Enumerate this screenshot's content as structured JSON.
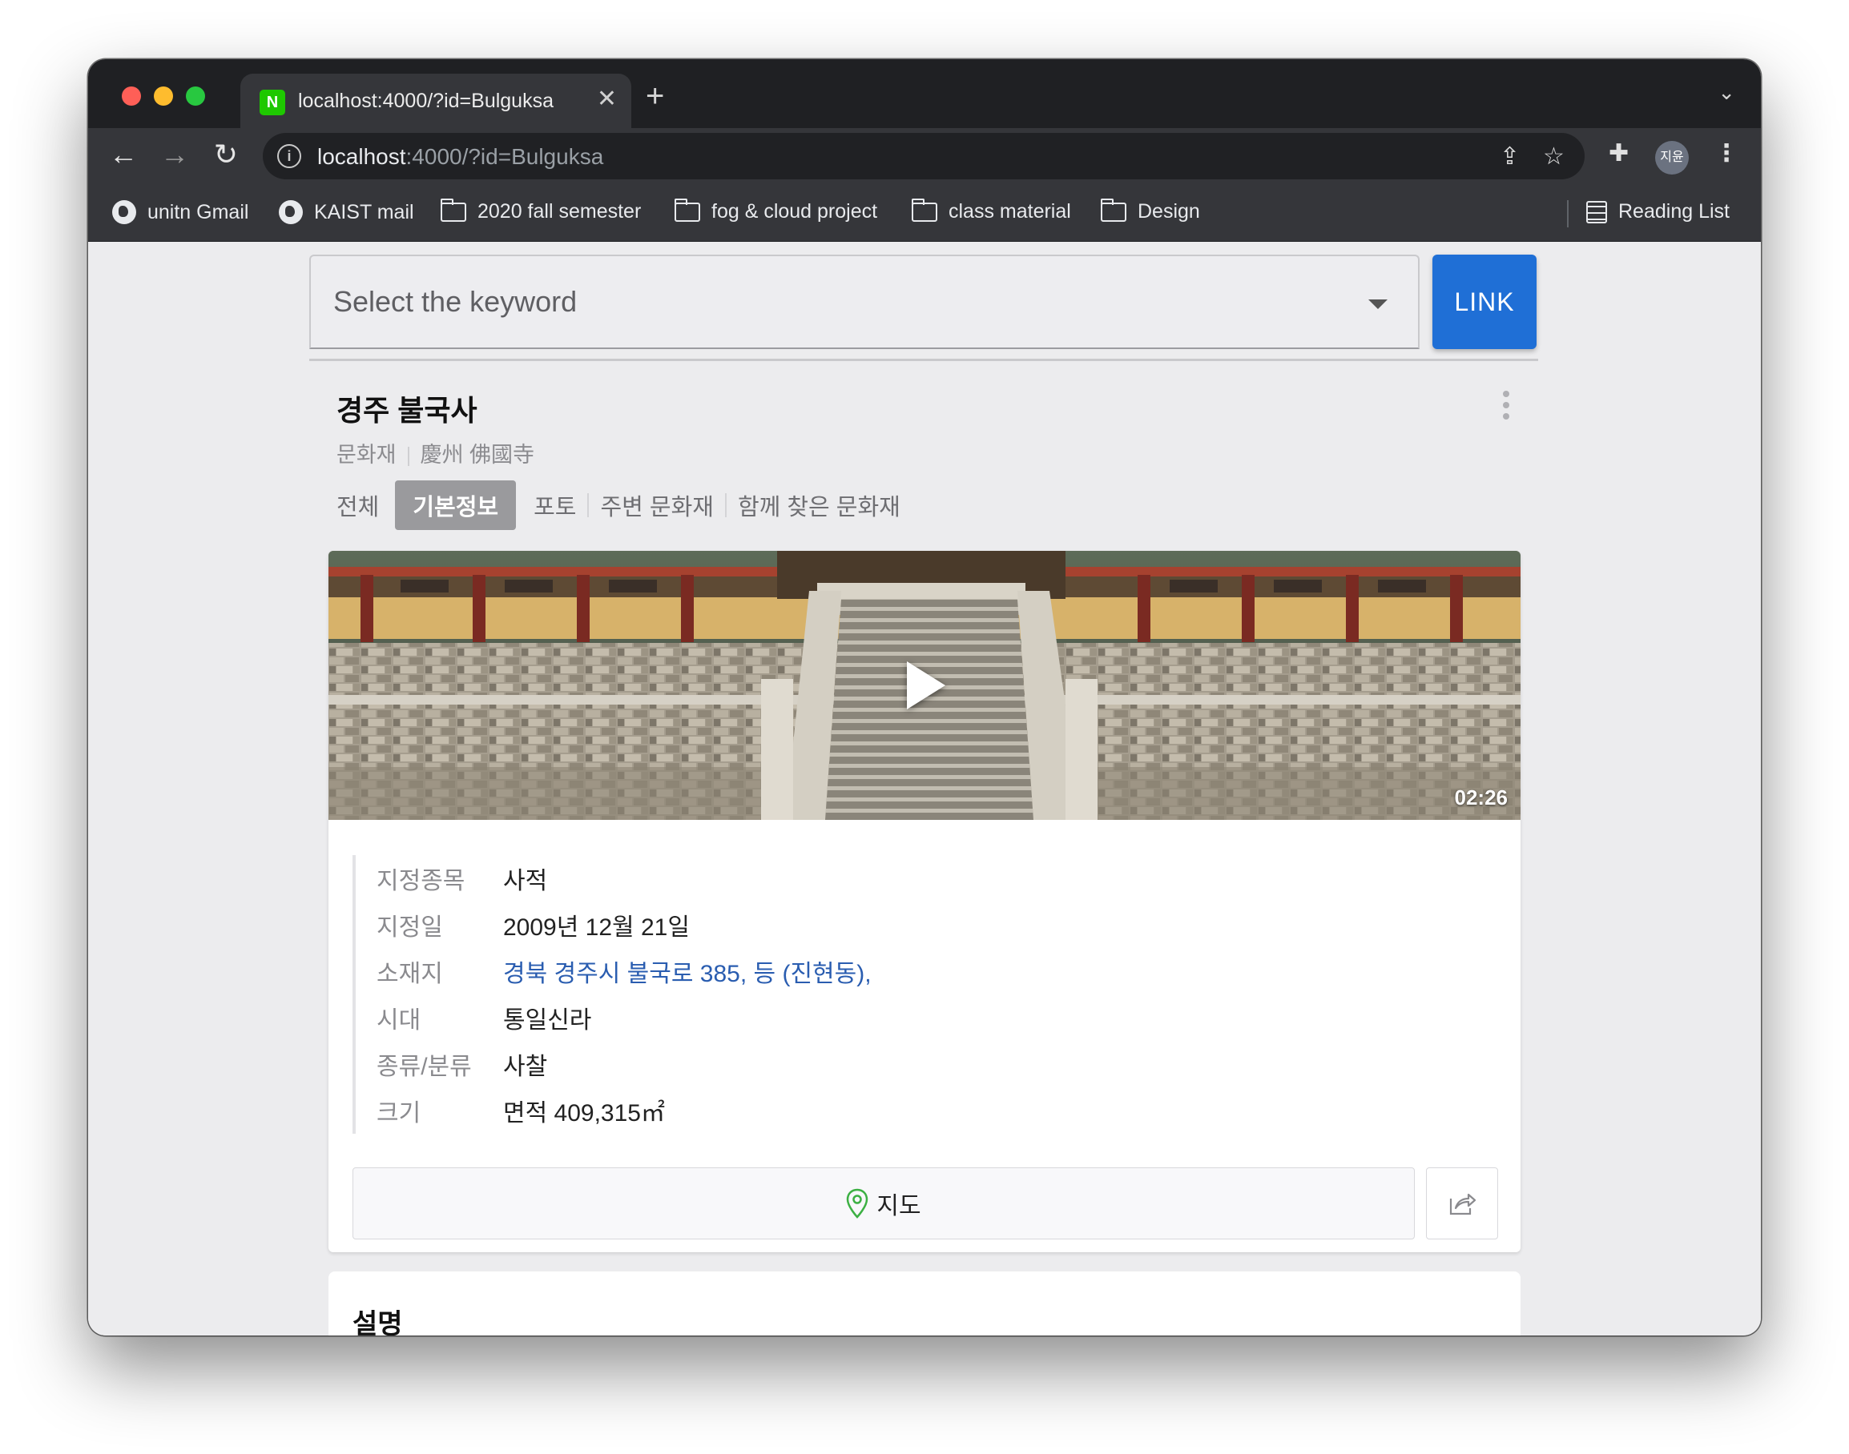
{
  "browser": {
    "tab_title": "localhost:4000/?id=Bulguksa",
    "tab_favicon_letter": "N",
    "url_host": "localhost",
    "url_rest": ":4000/?id=Bulguksa",
    "avatar_label": "지윤",
    "bookmarks": [
      {
        "label": "unitn Gmail",
        "icon": "globe-icon"
      },
      {
        "label": "KAIST mail",
        "icon": "globe-icon"
      },
      {
        "label": "2020 fall semester",
        "icon": "folder-icon"
      },
      {
        "label": "fog & cloud project",
        "icon": "folder-icon"
      },
      {
        "label": "class material",
        "icon": "folder-icon"
      },
      {
        "label": "Design",
        "icon": "folder-icon"
      }
    ],
    "reading_list": "Reading List"
  },
  "search": {
    "placeholder": "Select the keyword",
    "link_button": "LINK"
  },
  "heritage": {
    "title": "경주 불국사",
    "category": "문화재",
    "hanja": "慶州 佛國寺",
    "tabs": [
      "전체",
      "기본정보",
      "포토",
      "주변 문화재",
      "함께 찾은 문화재"
    ],
    "active_tab": "기본정보",
    "video_duration": "02:26",
    "details": [
      {
        "label": "지정종목",
        "value": "사적"
      },
      {
        "label": "지정일",
        "value": "2009년 12월 21일"
      },
      {
        "label": "소재지",
        "value": "경북 경주시 불국로 385, 등 (진현동),"
      },
      {
        "label": "시대",
        "value": "통일신라"
      },
      {
        "label": "종류/분류",
        "value": "사찰"
      },
      {
        "label": "크기",
        "value": "면적 409,315㎡"
      }
    ],
    "map_button": "지도",
    "description_title": "설명"
  },
  "colors": {
    "accent": "#1f6fd6",
    "link": "#2a5db0",
    "active_tab_bg": "#9a9a9d",
    "map_pin": "#3cb043"
  }
}
